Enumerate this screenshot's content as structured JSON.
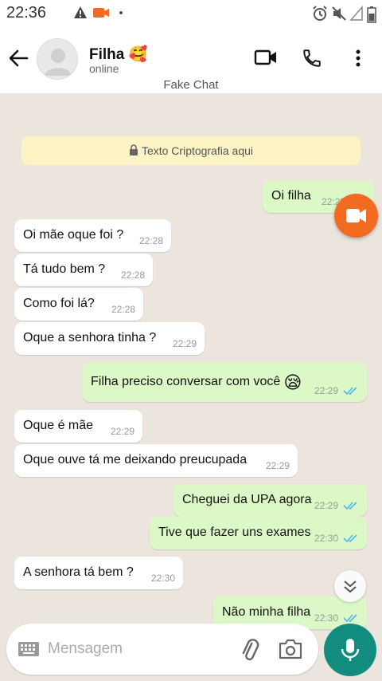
{
  "status_bar": {
    "time": "22:36"
  },
  "header": {
    "name": "Filha",
    "status": "online",
    "watermark": "Fake Chat",
    "name_emoji": "🥰"
  },
  "chat": {
    "encryption_notice": "Texto Criptografia aqui",
    "messages": [
      {
        "dir": "out",
        "text": "Oi filha",
        "time": "22:28"
      },
      {
        "dir": "in",
        "text": "Oi mãe oque foi ?",
        "time": "22:28"
      },
      {
        "dir": "in",
        "text": "Tá tudo bem ?",
        "time": "22:28"
      },
      {
        "dir": "in",
        "text": "Como foi lá?",
        "time": "22:28"
      },
      {
        "dir": "in",
        "text": "Oque a senhora tinha ?",
        "time": "22:29"
      },
      {
        "dir": "out",
        "text": "Filha preciso conversar com você",
        "emoji": "😪",
        "time": "22:29"
      },
      {
        "dir": "in",
        "text": "Oque é mãe",
        "time": "22:29"
      },
      {
        "dir": "in",
        "text": "Oque ouve tá me deixando preucupada",
        "time": "22:29"
      },
      {
        "dir": "out",
        "text": "Cheguei da UPA agora",
        "time": "22:29"
      },
      {
        "dir": "out",
        "text": "Tive que fazer uns exames",
        "time": "22:30"
      },
      {
        "dir": "in",
        "text": "A senhora tá bem ?",
        "time": "22:30"
      },
      {
        "dir": "out",
        "text": "Não minha filha",
        "time": "22:30"
      }
    ]
  },
  "input": {
    "placeholder": "Mensagem"
  },
  "colors": {
    "accent": "#128c7e",
    "outgoing_bubble": "#dcf8c6",
    "incoming_bubble": "#ffffff",
    "read_ticks": "#4fb6ec",
    "float_button": "#f26b21",
    "encryption_notice_bg": "#fcf4c4"
  },
  "icons": {
    "status": [
      "warning-icon",
      "video-recording-icon",
      "dot-icon",
      "alarm-icon",
      "mute-icon",
      "signal-icon",
      "battery-icon"
    ],
    "header": [
      "back-arrow-icon",
      "video-call-icon",
      "phone-icon",
      "more-options-icon"
    ],
    "input": [
      "keyboard-icon",
      "attach-icon",
      "camera-icon",
      "microphone-icon"
    ]
  }
}
